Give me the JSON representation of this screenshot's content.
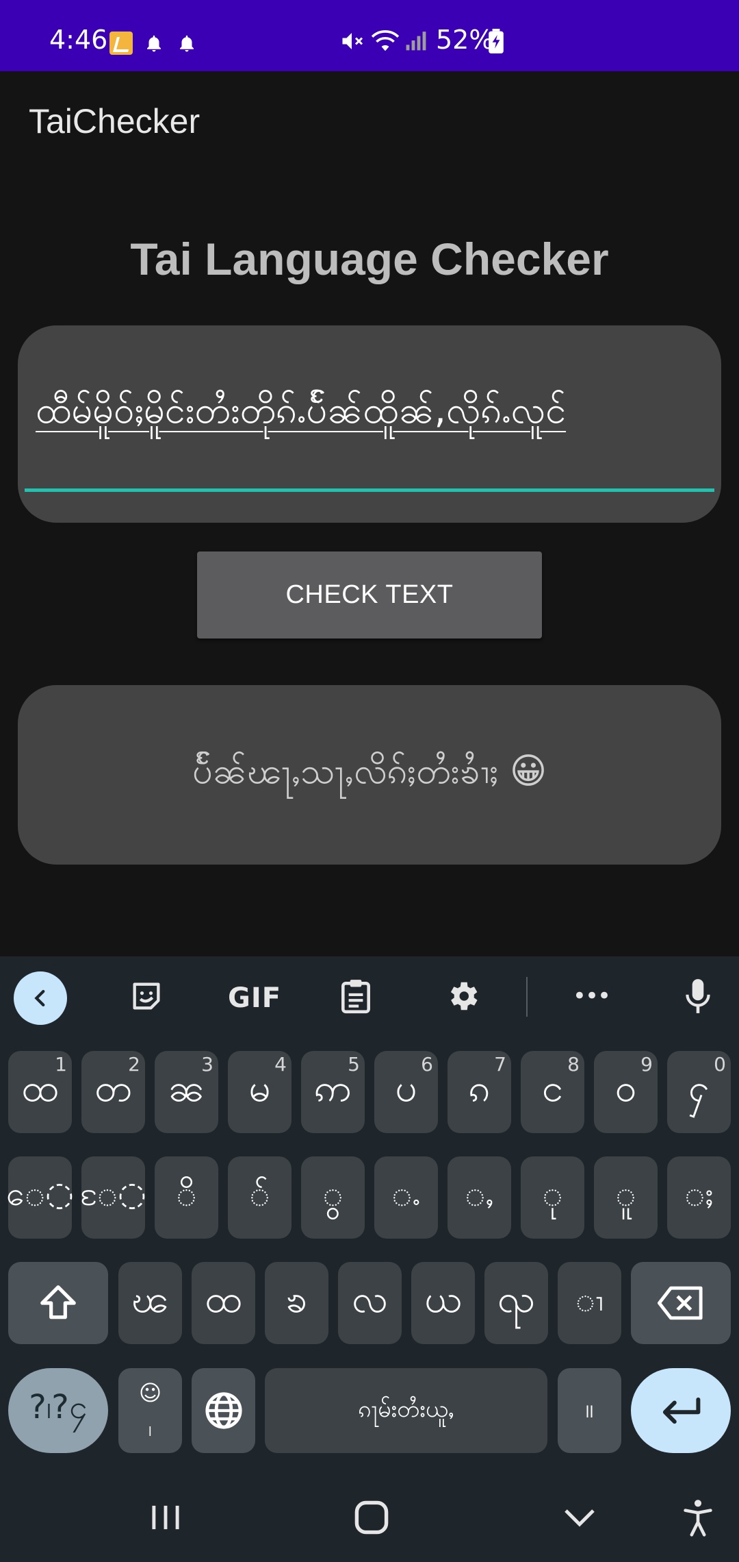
{
  "status_bar": {
    "time": "4:46",
    "battery": "52%",
    "background_color": "#3b00b3"
  },
  "app": {
    "title": "TaiChecker"
  },
  "main": {
    "heading": "Tai Language Checker",
    "input_value": "ထီမ်မိူဝ်ႈမိူင်းတႆးတိုၵ်ႉပ်ႅၼ်ထိူၼ်,လိုၵ်ႉလူင်",
    "check_button_label": "CHECK TEXT",
    "result_text": "ပ်ႅၼ်ၽႃႇသႃႇလိၵ်ႈတႆးၶၢႆႈ 😀",
    "accent_color": "#22c2b0"
  },
  "keyboard": {
    "toolbar": {
      "gif_label": "GIF",
      "more_label": "•••"
    },
    "row1": [
      {
        "key": "ထ",
        "hint": "1"
      },
      {
        "key": "တ",
        "hint": "2"
      },
      {
        "key": "ၼ",
        "hint": "3"
      },
      {
        "key": "မ",
        "hint": "4"
      },
      {
        "key": "ဢ",
        "hint": "5"
      },
      {
        "key": "ပ",
        "hint": "6"
      },
      {
        "key": "ၵ",
        "hint": "7"
      },
      {
        "key": "င",
        "hint": "8"
      },
      {
        "key": "ဝ",
        "hint": "9"
      },
      {
        "key": "ႁ",
        "hint": "0"
      }
    ],
    "row2": [
      "ေ◌",
      "ႄ◌",
      "◌ိ",
      "◌်",
      "◌ွ",
      "◌ႉ",
      "◌ႇ",
      "◌ု",
      "◌ူ",
      "◌ႈ"
    ],
    "row3": [
      "ၽ",
      "ထ",
      "ၶ",
      "လ",
      "ယ",
      "ၺ",
      "◌ၢ"
    ],
    "space_label": "ၵႃမ်းတႆးယူႇ",
    "symbols_label": "?၊?၄",
    "emoji_comma_label": "☺\n၊",
    "period_label": "။"
  },
  "icons": {
    "status": [
      "bell-icon",
      "bell-icon",
      "mute-icon",
      "wifi-icon",
      "signal-icon",
      "battery-icon"
    ],
    "keyboard_toolbar": [
      "back-icon",
      "sticker-icon",
      "clipboard-icon",
      "settings-icon",
      "mic-icon"
    ],
    "nav": [
      "recents-icon",
      "home-icon",
      "hide-keyboard-icon",
      "accessibility-icon"
    ]
  }
}
